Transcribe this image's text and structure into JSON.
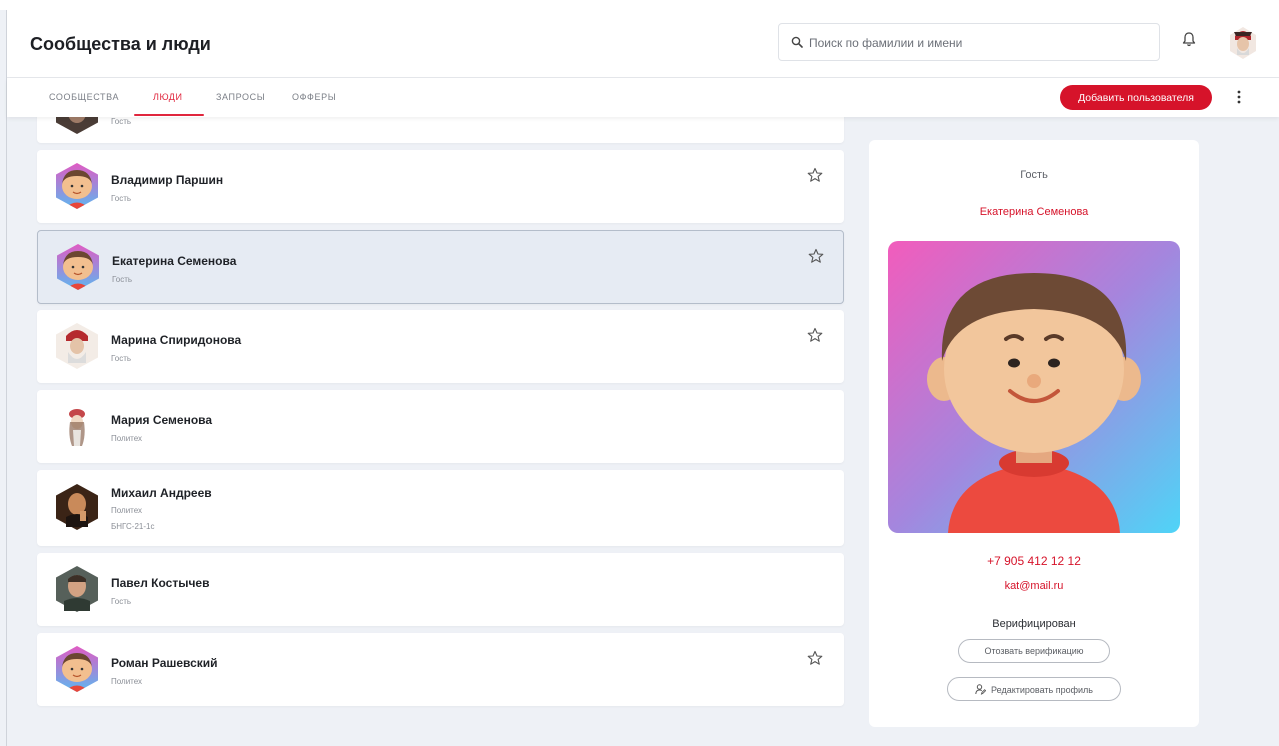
{
  "header": {
    "title": "Сообщества и люди",
    "search_placeholder": "Поиск по фамилии и имени"
  },
  "tabs": [
    {
      "label": "СООБЩЕСТВА",
      "active": false
    },
    {
      "label": "ЛЮДИ",
      "active": true
    },
    {
      "label": "ЗАПРОСЫ",
      "active": false
    },
    {
      "label": "ОФФЕРЫ",
      "active": false
    }
  ],
  "actions": {
    "add_user_label": "Добавить пользователя"
  },
  "people": [
    {
      "name": "",
      "role": "Гость",
      "avatar": "dark-portrait"
    },
    {
      "name": "Владимир Паршин",
      "role": "Гость",
      "avatar": "cartoon-boy",
      "starred": true
    },
    {
      "name": "Екатерина Семенова",
      "role": "Гость",
      "avatar": "cartoon-boy",
      "starred": true,
      "selected": true
    },
    {
      "name": "Марина Спиридонова",
      "role": "Гость",
      "avatar": "costume-portrait",
      "starred": true
    },
    {
      "name": "Мария Семенова",
      "role": "Политех",
      "avatar": "folk-girl"
    },
    {
      "name": "Михаил Андреев",
      "role": "Политех",
      "group": "БНГС-21-1с",
      "avatar": "man-photo"
    },
    {
      "name": "Павел Костычев",
      "role": "Гость",
      "avatar": "man-photo-2"
    },
    {
      "name": "Роман Рашевский",
      "role": "Политех",
      "avatar": "cartoon-boy",
      "starred": true
    }
  ],
  "detail": {
    "role": "Гость",
    "name": "Екатерина Семенова",
    "phone": "+7 905 412 12 12",
    "email": "kat@mail.ru",
    "status": "Верифицирован",
    "revoke_label": "Отозвать верификацию",
    "edit_label": "Редактировать профиль"
  },
  "colors": {
    "accent": "#d6132a",
    "background": "#eef1f6",
    "selected_row": "#e6ebf3"
  },
  "icons": [
    "search-icon",
    "bell-icon",
    "star-icon",
    "more-vertical-icon",
    "user-edit-icon"
  ]
}
